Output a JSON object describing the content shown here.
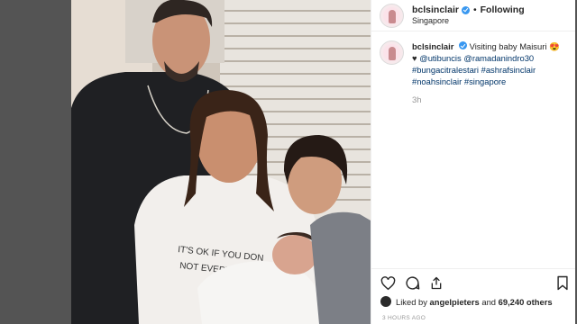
{
  "post": {
    "username": "bclsinclair",
    "follow_label": "Following",
    "location": "Singapore",
    "caption": {
      "username": "bclsinclair",
      "text": "Visiting baby Maisuri 😍",
      "heart": "♥",
      "mentions": [
        "@utibuncis",
        "@ramadanindro30"
      ],
      "hashtags": [
        "#bungacitralestari",
        "#ashrafsinclair",
        "#noahsinclair",
        "#singapore"
      ]
    },
    "time": "3h",
    "likes": {
      "prefix": "Liked by",
      "user": "angelpieters",
      "and": "and",
      "count": "69,240 others"
    },
    "posted_ago": "3 HOURS AGO"
  },
  "icons": {
    "verified": "verified-badge-icon",
    "like": "heart-icon",
    "comment": "comment-icon",
    "share": "share-icon",
    "save": "bookmark-icon"
  },
  "colors": {
    "verified": "#3897f0",
    "link": "#003569",
    "muted": "#999999",
    "text": "#262626",
    "backdrop": "#545454"
  }
}
